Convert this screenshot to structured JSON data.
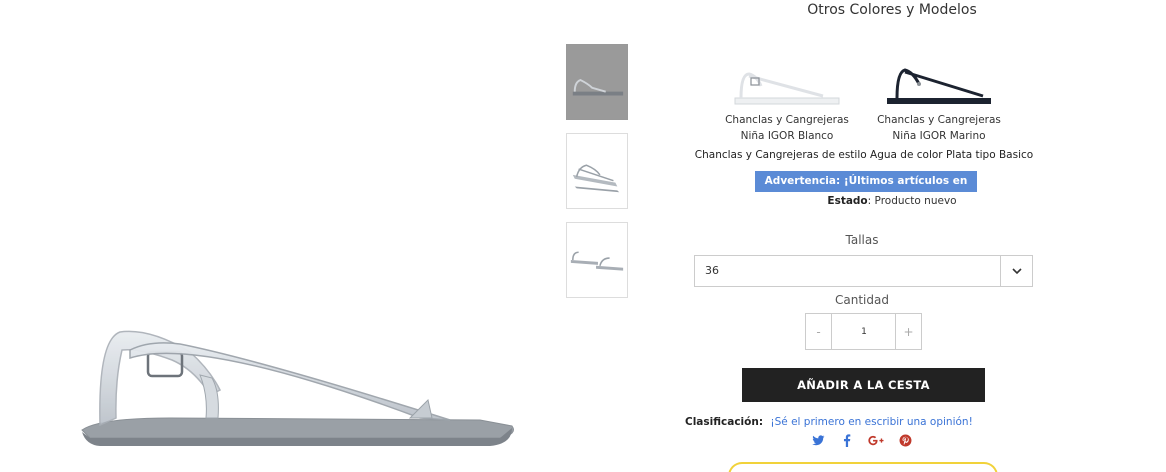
{
  "title": "Otros Colores y Modelos",
  "variants": [
    {
      "label": "Chanclas y Cangrejeras Niña IGOR Blanco",
      "color": "white"
    },
    {
      "label": "Chanclas y Cangrejeras Niña IGOR Marino",
      "color": "navy"
    }
  ],
  "description": "Chanclas y Cangrejeras de estilo Agua de color Plata tipo Basico",
  "warning": "Advertencia: ¡Últimos artículos en stock!",
  "estado": {
    "label": "Estado",
    "value": "Producto nuevo"
  },
  "tallas": {
    "label": "Tallas",
    "selected": "36"
  },
  "cantidad": {
    "label": "Cantidad",
    "value": "1",
    "minus": "-",
    "plus": "+"
  },
  "add_to_cart": "AÑADIR A LA CESTA",
  "clasificacion": {
    "label": "Clasificación:",
    "link": "¡Sé el primero en escribir una opinión!"
  },
  "social": [
    "twitter-icon",
    "facebook-icon",
    "google-plus-icon",
    "pinterest-icon"
  ],
  "colors": {
    "warning_bg": "#5b8bd6",
    "button_bg": "#222222",
    "link": "#3a73d6",
    "banner_border": "#f1d23a"
  }
}
